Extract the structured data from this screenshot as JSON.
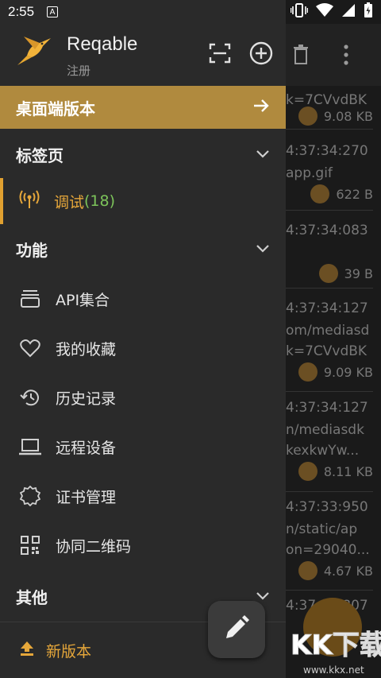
{
  "status_bar": {
    "time": "2:55",
    "badge": "A"
  },
  "header": {
    "app_name": "Reqable",
    "subtitle": "注册"
  },
  "desktop_banner": {
    "label": "桌面端版本"
  },
  "sections": {
    "tabs": "标签页",
    "features": "功能",
    "others": "其他"
  },
  "tab_item": {
    "label": "调试",
    "count": "(18)"
  },
  "menu": [
    {
      "label": "API集合",
      "icon": "collection-icon"
    },
    {
      "label": "我的收藏",
      "icon": "heart-icon"
    },
    {
      "label": "历史记录",
      "icon": "history-icon"
    },
    {
      "label": "远程设备",
      "icon": "laptop-icon"
    },
    {
      "label": "证书管理",
      "icon": "certificate-icon"
    },
    {
      "label": "协同二维码",
      "icon": "qr-code-icon"
    }
  ],
  "update": {
    "label": "新版本"
  },
  "background_list": {
    "rows": [
      {
        "lines": [
          "k=7CVvdBK"
        ],
        "size": "9.08 KB"
      },
      {
        "lines": [
          "4:37:34:270",
          "app.gif"
        ],
        "size": "622 B"
      },
      {
        "lines": [
          "4:37:34:083"
        ],
        "size": "39 B"
      },
      {
        "lines": [
          "4:37:34:127",
          "om/mediasd",
          "k=7CVvdBK"
        ],
        "size": "9.09 KB"
      },
      {
        "lines": [
          "4:37:34:127",
          "n/mediasdk",
          "kexkwYw..."
        ],
        "size": "8.11 KB"
      },
      {
        "lines": [
          "4:37:33:950",
          "n/static/ap",
          "on=29040..."
        ],
        "size": "4.67 KB"
      },
      {
        "lines": [
          "4:37:33:807"
        ],
        "size": ""
      }
    ]
  },
  "watermark": {
    "text": "KK下载",
    "url": "www.kkx.net"
  },
  "colors": {
    "accent": "#b08a3e",
    "orange": "#e6a73a",
    "green": "#7cc35a",
    "drawer": "#2a2a2a"
  }
}
